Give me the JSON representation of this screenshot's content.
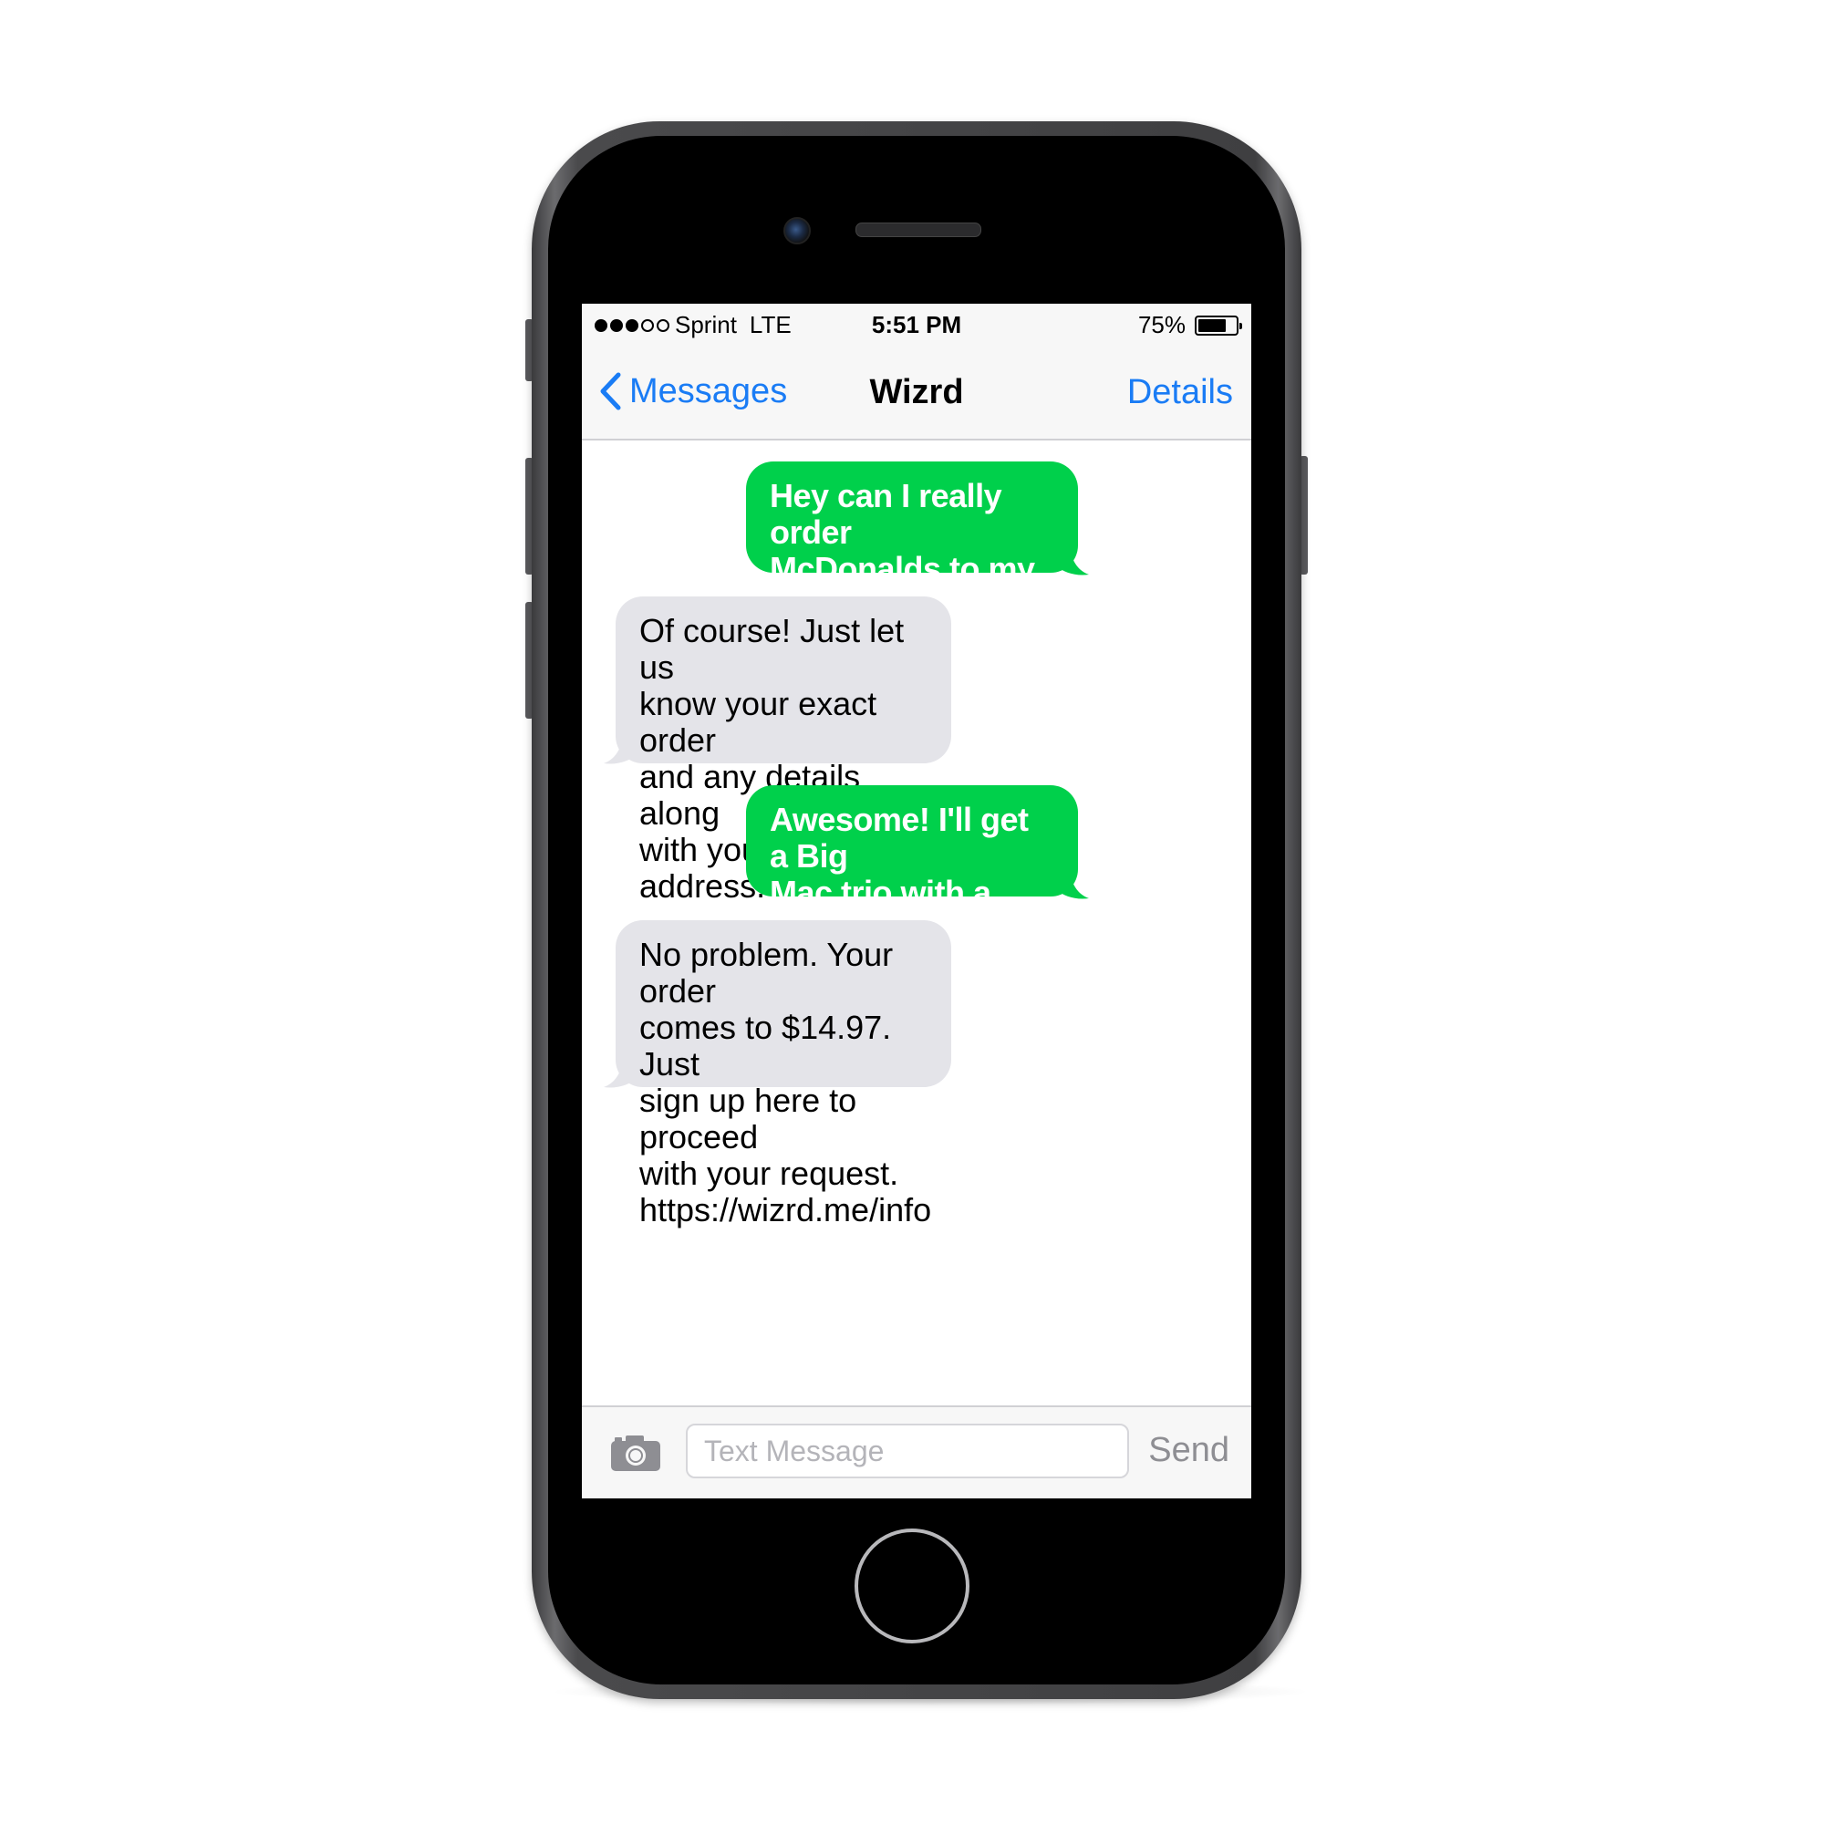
{
  "status_bar": {
    "signal_bars_filled": 3,
    "signal_bars_total": 5,
    "carrier": "Sprint",
    "network": "LTE",
    "time": "5:51 PM",
    "battery_percent": "75%",
    "battery_level": 0.75
  },
  "nav": {
    "back_label": "Messages",
    "title": "Wizrd",
    "details_label": "Details",
    "accent_color": "#1a7cf5"
  },
  "messages": [
    {
      "direction": "sent",
      "text": "Hey can I really order\nMcDonalds to my\nhouse?"
    },
    {
      "direction": "received",
      "text": "Of course! Just let us\nknow your exact order\nand any details along\nwith your delivery\naddress."
    },
    {
      "direction": "sent",
      "text": "Awesome! I'll get a Big\nMac trio with a large\nCoke."
    },
    {
      "direction": "received",
      "text": "No problem. Your order\ncomes to $14.97. Just\nsign up here to proceed\nwith your request.\nhttps://wizrd.me/info"
    }
  ],
  "colors": {
    "sent_bubble": "#00d04b",
    "received_bubble": "#e4e4e9"
  },
  "composer": {
    "camera_icon": "camera-icon",
    "placeholder": "Text Message",
    "value": "",
    "send_label": "Send"
  }
}
